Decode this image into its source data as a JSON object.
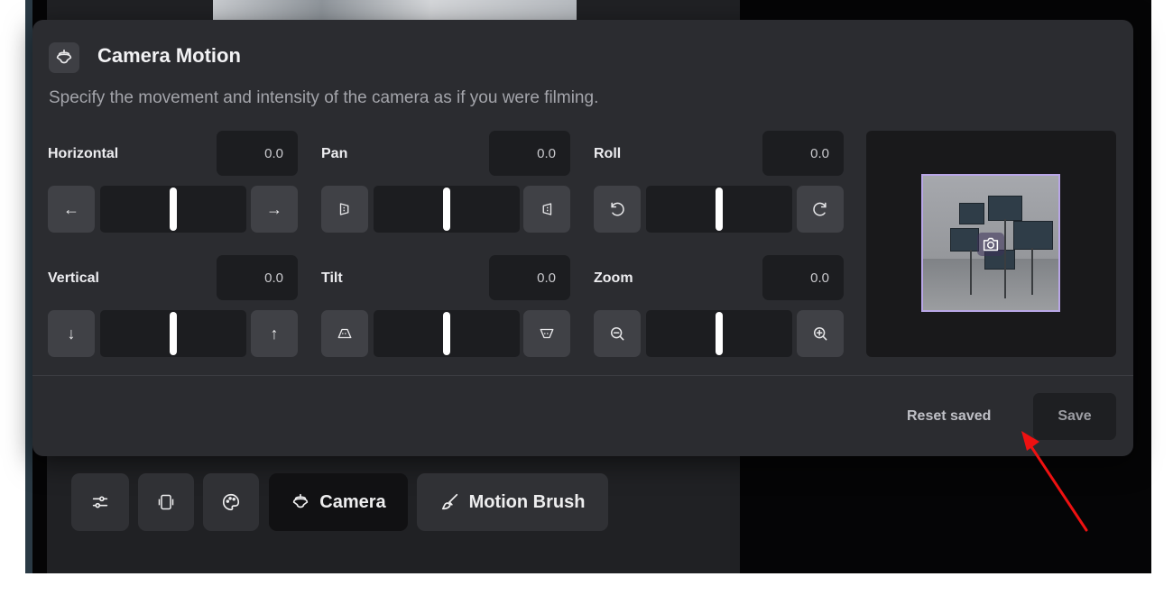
{
  "dialog": {
    "title": "Camera Motion",
    "subtitle": "Specify the movement and intensity of the camera as if you were filming.",
    "icon": "camera-motion-icon"
  },
  "controls": {
    "horizontal": {
      "label": "Horizontal",
      "value": "0.0",
      "slider_position": 0.5,
      "decrease_icon": "arrow-left-icon",
      "increase_icon": "arrow-right-icon"
    },
    "pan": {
      "label": "Pan",
      "value": "0.0",
      "slider_position": 0.5,
      "decrease_icon": "pan-left-icon",
      "increase_icon": "pan-right-icon"
    },
    "roll": {
      "label": "Roll",
      "value": "0.0",
      "slider_position": 0.5,
      "decrease_icon": "rotate-ccw-icon",
      "increase_icon": "rotate-cw-icon"
    },
    "vertical": {
      "label": "Vertical",
      "value": "0.0",
      "slider_position": 0.5,
      "decrease_icon": "arrow-down-icon",
      "increase_icon": "arrow-up-icon"
    },
    "tilt": {
      "label": "Tilt",
      "value": "0.0",
      "slider_position": 0.5,
      "decrease_icon": "tilt-up-icon",
      "increase_icon": "tilt-down-icon"
    },
    "zoom": {
      "label": "Zoom",
      "value": "0.0",
      "slider_position": 0.5,
      "decrease_icon": "zoom-out-icon",
      "increase_icon": "zoom-in-icon"
    }
  },
  "footer": {
    "reset_label": "Reset saved",
    "save_label": "Save"
  },
  "toolbar": {
    "items": [
      {
        "icon": "sliders-icon",
        "label": ""
      },
      {
        "icon": "frames-icon",
        "label": ""
      },
      {
        "icon": "palette-icon",
        "label": ""
      },
      {
        "icon": "camera-motion-icon",
        "label": "Camera",
        "active": true
      },
      {
        "icon": "brush-icon",
        "label": "Motion Brush"
      }
    ]
  },
  "colors": {
    "modal_bg": "#2b2c30",
    "preview_border": "#b8a6e6",
    "annotation_arrow": "#ee1111"
  }
}
